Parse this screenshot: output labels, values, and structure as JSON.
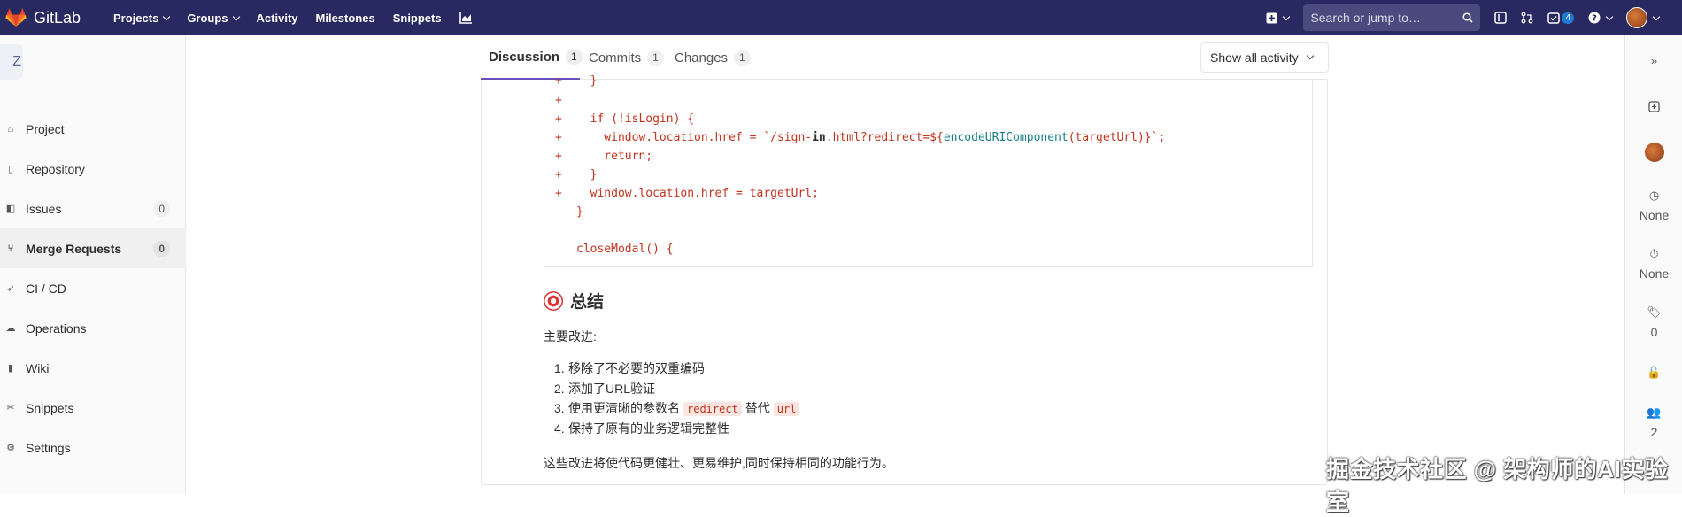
{
  "navbar": {
    "brand": "GitLab",
    "links": [
      {
        "label": "Projects",
        "dropdown": true
      },
      {
        "label": "Groups",
        "dropdown": true
      },
      {
        "label": "Activity",
        "dropdown": false
      },
      {
        "label": "Milestones",
        "dropdown": false
      },
      {
        "label": "Snippets",
        "dropdown": false
      }
    ],
    "search_placeholder": "Search or jump to…",
    "todos_count": "4"
  },
  "sidebar": {
    "project_letter": "Z",
    "items": [
      {
        "label": "Project",
        "icon": "home-icon"
      },
      {
        "label": "Repository",
        "icon": "doc-icon"
      },
      {
        "label": "Issues",
        "icon": "issues-icon",
        "count": "0"
      },
      {
        "label": "Merge Requests",
        "icon": "merge-request-icon",
        "count": "0",
        "active": true
      },
      {
        "label": "CI / CD",
        "icon": "rocket-icon"
      },
      {
        "label": "Operations",
        "icon": "cloud-gear-icon"
      },
      {
        "label": "Wiki",
        "icon": "book-icon"
      },
      {
        "label": "Snippets",
        "icon": "scissors-icon"
      },
      {
        "label": "Settings",
        "icon": "gear-icon"
      }
    ]
  },
  "tabs": [
    {
      "label": "Discussion",
      "count": "1",
      "active": true
    },
    {
      "label": "Commits",
      "count": "1"
    },
    {
      "label": "Changes",
      "count": "1"
    }
  ],
  "activity_filter": "Show all activity",
  "code_lines": [
    {
      "plus": "+",
      "text": "  }"
    },
    {
      "plus": "+",
      "text": ""
    },
    {
      "plus": "+",
      "text": "  if (!isLogin) {"
    },
    {
      "plus": "+",
      "text_pre": "    window.location.href = `/sign-",
      "bold": "in",
      "text_mid": ".html?redirect=${",
      "fn": "encodeURIComponent",
      "text_post": "(targetUrl)}`;"
    },
    {
      "plus": "+",
      "text": "    return;"
    },
    {
      "plus": "+",
      "text": "  }"
    },
    {
      "plus": "+",
      "text": "  window.location.href = targetUrl;"
    },
    {
      "plus": "",
      "text": "}"
    },
    {
      "plus": "",
      "text": ""
    },
    {
      "plus": "",
      "text": "closeModal() {"
    }
  ],
  "summary": {
    "heading": "总结",
    "intro": "主要改进:",
    "items": [
      {
        "num": "1.",
        "text": "移除了不必要的双重编码"
      },
      {
        "num": "2.",
        "text": "添加了URL验证"
      },
      {
        "num": "3.",
        "text_pre": "使用更清晰的参数名",
        "code1": "redirect",
        "text_mid": "替代",
        "code2": "url"
      },
      {
        "num": "4.",
        "text": "保持了原有的业务逻辑完整性"
      }
    ],
    "conclusion": "这些改进将使代码更健壮、更易维护,同时保持相同的功能行为。"
  },
  "right_sidebar": {
    "milestone": "None",
    "time_tracking": "None",
    "labels": "0",
    "participants": "2"
  },
  "watermark": "掘金技术社区 @ 架构师的AI实验室"
}
